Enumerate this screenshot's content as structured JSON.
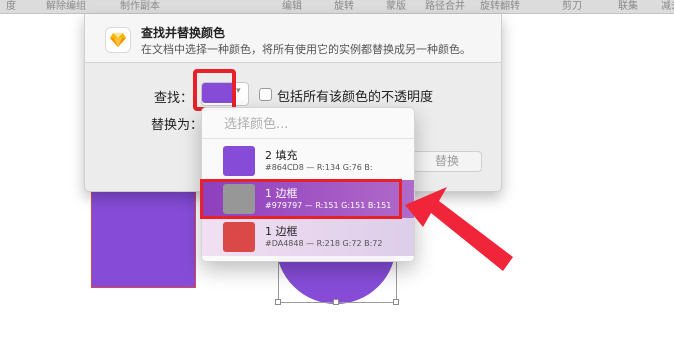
{
  "menubar": {
    "items": [
      "度",
      "解除编组",
      "制作副本",
      "编辑",
      "旋转",
      "蒙版",
      "路径合并",
      "旋转翻转",
      "剪刀",
      "联集",
      "减去"
    ]
  },
  "dialog": {
    "title": "查找并替换颜色",
    "subtitle": "在文档中选择一种颜色，将所有使用它的实例都替换成另一种颜色。",
    "find_label": "查找：",
    "replace_label": "替换为：",
    "include_opacity_label": "包括所有该颜色的不透明度",
    "include_opacity_checked": false,
    "find_color": "#864CD8",
    "replace_button": "替换"
  },
  "dropdown": {
    "placeholder": "选择颜色...",
    "items": [
      {
        "name": "2 填充",
        "detail": "#864CD8 — R:134 G:76 B:",
        "color": "#864CD8",
        "selected": false
      },
      {
        "name": "1 边框",
        "detail": "#979797 — R:151 G:151 B:151",
        "color": "#979797",
        "selected": true
      },
      {
        "name": "1 边框",
        "detail": "#DA4848 — R:218 G:72 B:72",
        "color": "#DA4848",
        "selected": false
      }
    ]
  },
  "colors": {
    "annotation_red": "#e8202a",
    "selection_purple": "#8e3fbd"
  }
}
